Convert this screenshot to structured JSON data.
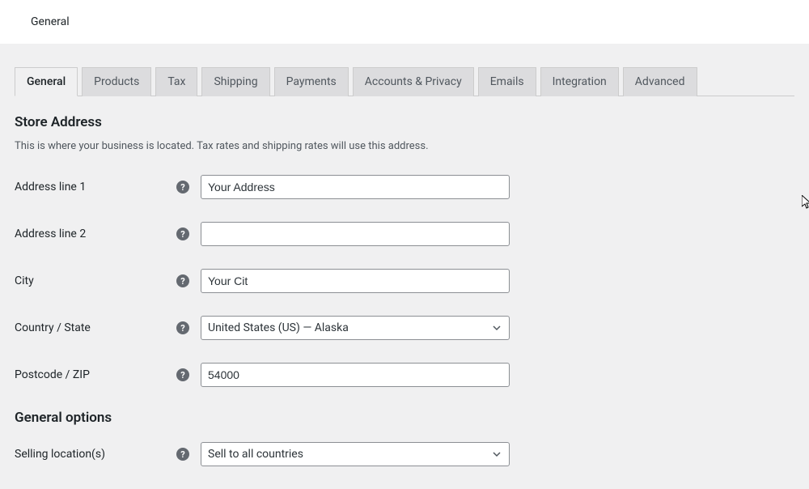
{
  "topbar": {
    "title": "General"
  },
  "tabs": [
    {
      "label": "General",
      "active": true
    },
    {
      "label": "Products",
      "active": false
    },
    {
      "label": "Tax",
      "active": false
    },
    {
      "label": "Shipping",
      "active": false
    },
    {
      "label": "Payments",
      "active": false
    },
    {
      "label": "Accounts & Privacy",
      "active": false
    },
    {
      "label": "Emails",
      "active": false
    },
    {
      "label": "Integration",
      "active": false
    },
    {
      "label": "Advanced",
      "active": false
    }
  ],
  "sections": {
    "store_address": {
      "title": "Store Address",
      "description": "This is where your business is located. Tax rates and shipping rates will use this address."
    },
    "general_options": {
      "title": "General options"
    }
  },
  "fields": {
    "address1": {
      "label": "Address line 1",
      "value": "Your Address"
    },
    "address2": {
      "label": "Address line 2",
      "value": ""
    },
    "city": {
      "label": "City",
      "value": "Your Cit"
    },
    "country_state": {
      "label": "Country / State",
      "value": "United States (US) — Alaska"
    },
    "postcode": {
      "label": "Postcode / ZIP",
      "value": "54000"
    },
    "selling_locations": {
      "label": "Selling location(s)",
      "value": "Sell to all countries"
    }
  }
}
